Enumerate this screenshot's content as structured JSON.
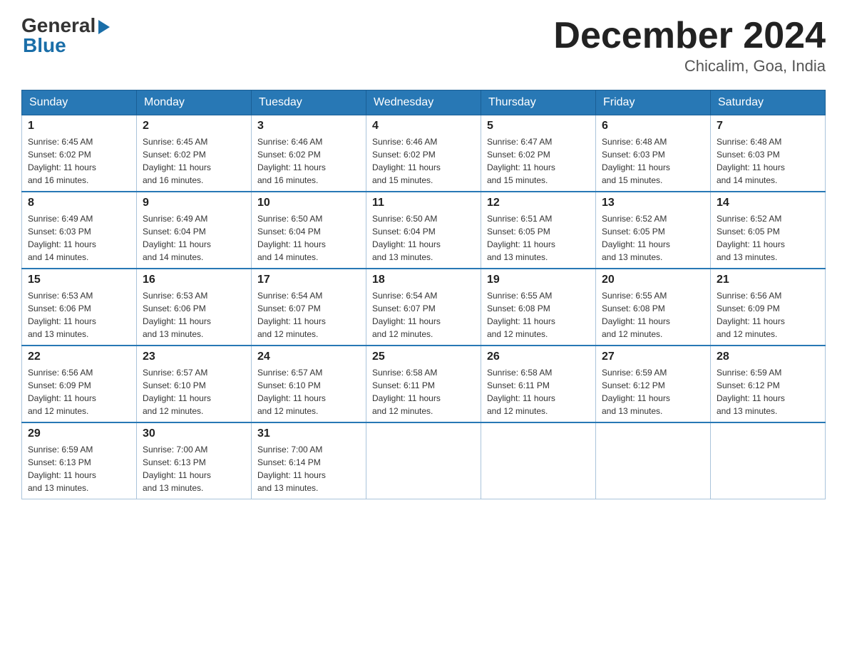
{
  "header": {
    "logo_general": "General",
    "logo_blue": "Blue",
    "title": "December 2024",
    "subtitle": "Chicalim, Goa, India"
  },
  "days_of_week": [
    "Sunday",
    "Monday",
    "Tuesday",
    "Wednesday",
    "Thursday",
    "Friday",
    "Saturday"
  ],
  "weeks": [
    [
      {
        "day": "1",
        "sunrise": "6:45 AM",
        "sunset": "6:02 PM",
        "daylight": "11 hours and 16 minutes."
      },
      {
        "day": "2",
        "sunrise": "6:45 AM",
        "sunset": "6:02 PM",
        "daylight": "11 hours and 16 minutes."
      },
      {
        "day": "3",
        "sunrise": "6:46 AM",
        "sunset": "6:02 PM",
        "daylight": "11 hours and 16 minutes."
      },
      {
        "day": "4",
        "sunrise": "6:46 AM",
        "sunset": "6:02 PM",
        "daylight": "11 hours and 15 minutes."
      },
      {
        "day": "5",
        "sunrise": "6:47 AM",
        "sunset": "6:02 PM",
        "daylight": "11 hours and 15 minutes."
      },
      {
        "day": "6",
        "sunrise": "6:48 AM",
        "sunset": "6:03 PM",
        "daylight": "11 hours and 15 minutes."
      },
      {
        "day": "7",
        "sunrise": "6:48 AM",
        "sunset": "6:03 PM",
        "daylight": "11 hours and 14 minutes."
      }
    ],
    [
      {
        "day": "8",
        "sunrise": "6:49 AM",
        "sunset": "6:03 PM",
        "daylight": "11 hours and 14 minutes."
      },
      {
        "day": "9",
        "sunrise": "6:49 AM",
        "sunset": "6:04 PM",
        "daylight": "11 hours and 14 minutes."
      },
      {
        "day": "10",
        "sunrise": "6:50 AM",
        "sunset": "6:04 PM",
        "daylight": "11 hours and 14 minutes."
      },
      {
        "day": "11",
        "sunrise": "6:50 AM",
        "sunset": "6:04 PM",
        "daylight": "11 hours and 13 minutes."
      },
      {
        "day": "12",
        "sunrise": "6:51 AM",
        "sunset": "6:05 PM",
        "daylight": "11 hours and 13 minutes."
      },
      {
        "day": "13",
        "sunrise": "6:52 AM",
        "sunset": "6:05 PM",
        "daylight": "11 hours and 13 minutes."
      },
      {
        "day": "14",
        "sunrise": "6:52 AM",
        "sunset": "6:05 PM",
        "daylight": "11 hours and 13 minutes."
      }
    ],
    [
      {
        "day": "15",
        "sunrise": "6:53 AM",
        "sunset": "6:06 PM",
        "daylight": "11 hours and 13 minutes."
      },
      {
        "day": "16",
        "sunrise": "6:53 AM",
        "sunset": "6:06 PM",
        "daylight": "11 hours and 13 minutes."
      },
      {
        "day": "17",
        "sunrise": "6:54 AM",
        "sunset": "6:07 PM",
        "daylight": "11 hours and 12 minutes."
      },
      {
        "day": "18",
        "sunrise": "6:54 AM",
        "sunset": "6:07 PM",
        "daylight": "11 hours and 12 minutes."
      },
      {
        "day": "19",
        "sunrise": "6:55 AM",
        "sunset": "6:08 PM",
        "daylight": "11 hours and 12 minutes."
      },
      {
        "day": "20",
        "sunrise": "6:55 AM",
        "sunset": "6:08 PM",
        "daylight": "11 hours and 12 minutes."
      },
      {
        "day": "21",
        "sunrise": "6:56 AM",
        "sunset": "6:09 PM",
        "daylight": "11 hours and 12 minutes."
      }
    ],
    [
      {
        "day": "22",
        "sunrise": "6:56 AM",
        "sunset": "6:09 PM",
        "daylight": "11 hours and 12 minutes."
      },
      {
        "day": "23",
        "sunrise": "6:57 AM",
        "sunset": "6:10 PM",
        "daylight": "11 hours and 12 minutes."
      },
      {
        "day": "24",
        "sunrise": "6:57 AM",
        "sunset": "6:10 PM",
        "daylight": "11 hours and 12 minutes."
      },
      {
        "day": "25",
        "sunrise": "6:58 AM",
        "sunset": "6:11 PM",
        "daylight": "11 hours and 12 minutes."
      },
      {
        "day": "26",
        "sunrise": "6:58 AM",
        "sunset": "6:11 PM",
        "daylight": "11 hours and 12 minutes."
      },
      {
        "day": "27",
        "sunrise": "6:59 AM",
        "sunset": "6:12 PM",
        "daylight": "11 hours and 13 minutes."
      },
      {
        "day": "28",
        "sunrise": "6:59 AM",
        "sunset": "6:12 PM",
        "daylight": "11 hours and 13 minutes."
      }
    ],
    [
      {
        "day": "29",
        "sunrise": "6:59 AM",
        "sunset": "6:13 PM",
        "daylight": "11 hours and 13 minutes."
      },
      {
        "day": "30",
        "sunrise": "7:00 AM",
        "sunset": "6:13 PM",
        "daylight": "11 hours and 13 minutes."
      },
      {
        "day": "31",
        "sunrise": "7:00 AM",
        "sunset": "6:14 PM",
        "daylight": "11 hours and 13 minutes."
      },
      null,
      null,
      null,
      null
    ]
  ],
  "labels": {
    "sunrise": "Sunrise:",
    "sunset": "Sunset:",
    "daylight": "Daylight:"
  }
}
